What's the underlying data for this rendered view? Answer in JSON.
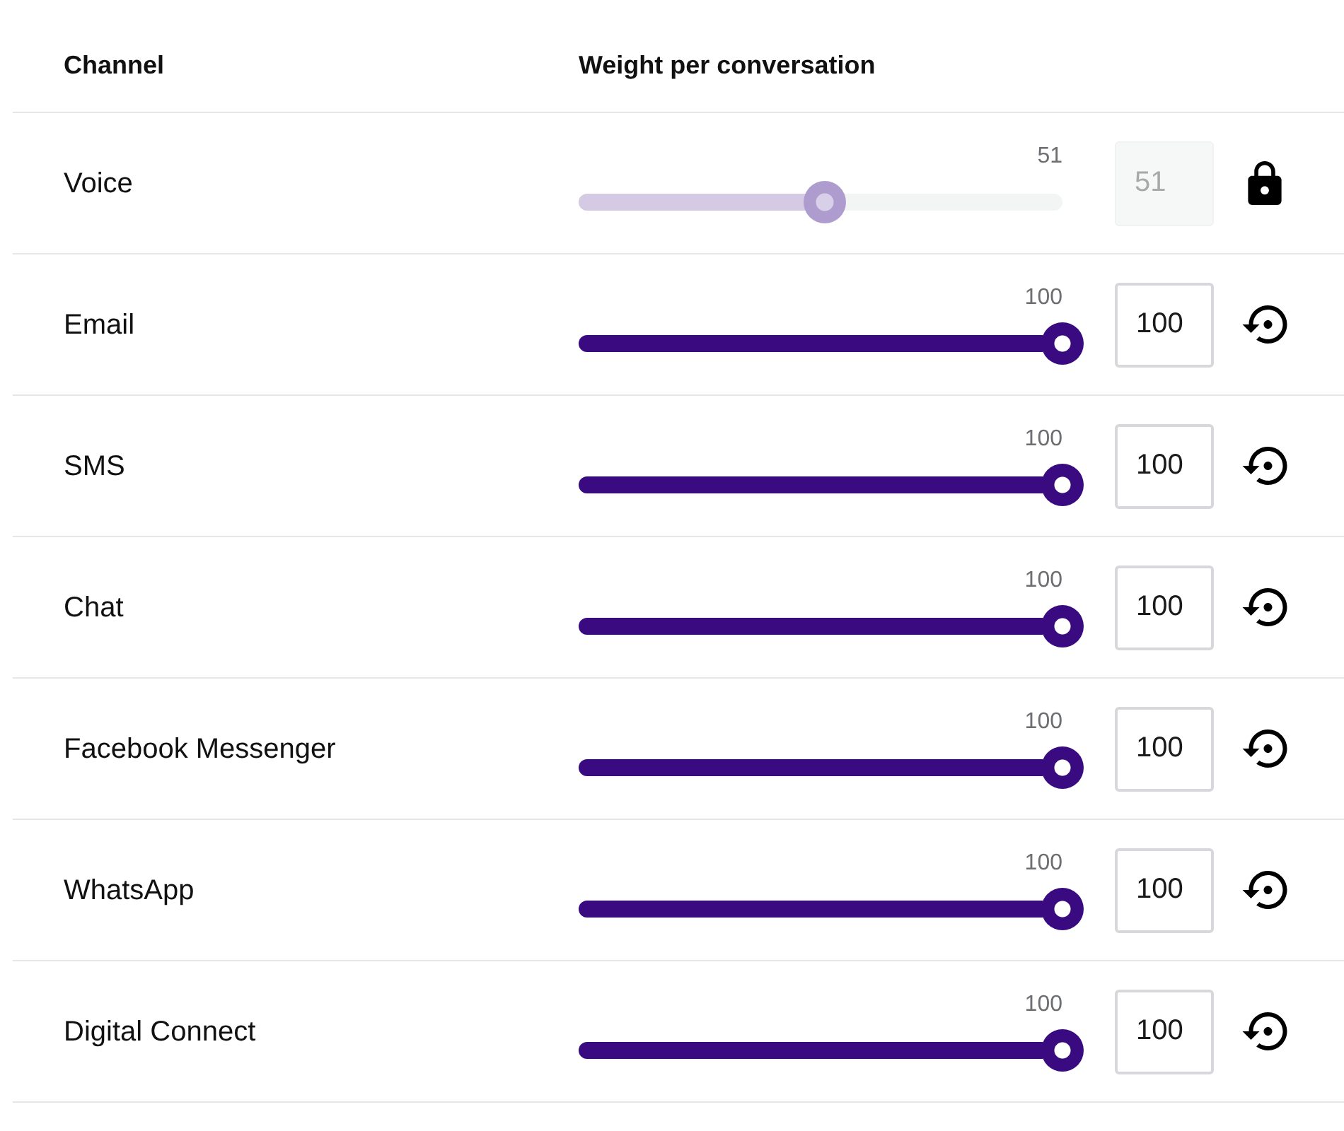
{
  "header": {
    "columns": [
      "Channel",
      "Weight per conversation"
    ]
  },
  "channels": [
    {
      "name": "Voice",
      "locked": true,
      "level": 0.51,
      "reading": "51",
      "value": "51"
    },
    {
      "name": "Email",
      "locked": false,
      "level": 1,
      "reading": "100",
      "value": "100"
    },
    {
      "name": "SMS",
      "locked": false,
      "level": 1,
      "reading": "100",
      "value": "100"
    },
    {
      "name": "Chat",
      "locked": false,
      "level": 1,
      "reading": "100",
      "value": "100"
    },
    {
      "name": "Facebook Messenger",
      "locked": false,
      "level": 1,
      "reading": "100",
      "value": "100"
    },
    {
      "name": "WhatsApp",
      "locked": false,
      "level": 1,
      "reading": "100",
      "value": "100"
    },
    {
      "name": "Digital Connect",
      "locked": false,
      "level": 1,
      "reading": "100",
      "value": "100"
    }
  ]
}
